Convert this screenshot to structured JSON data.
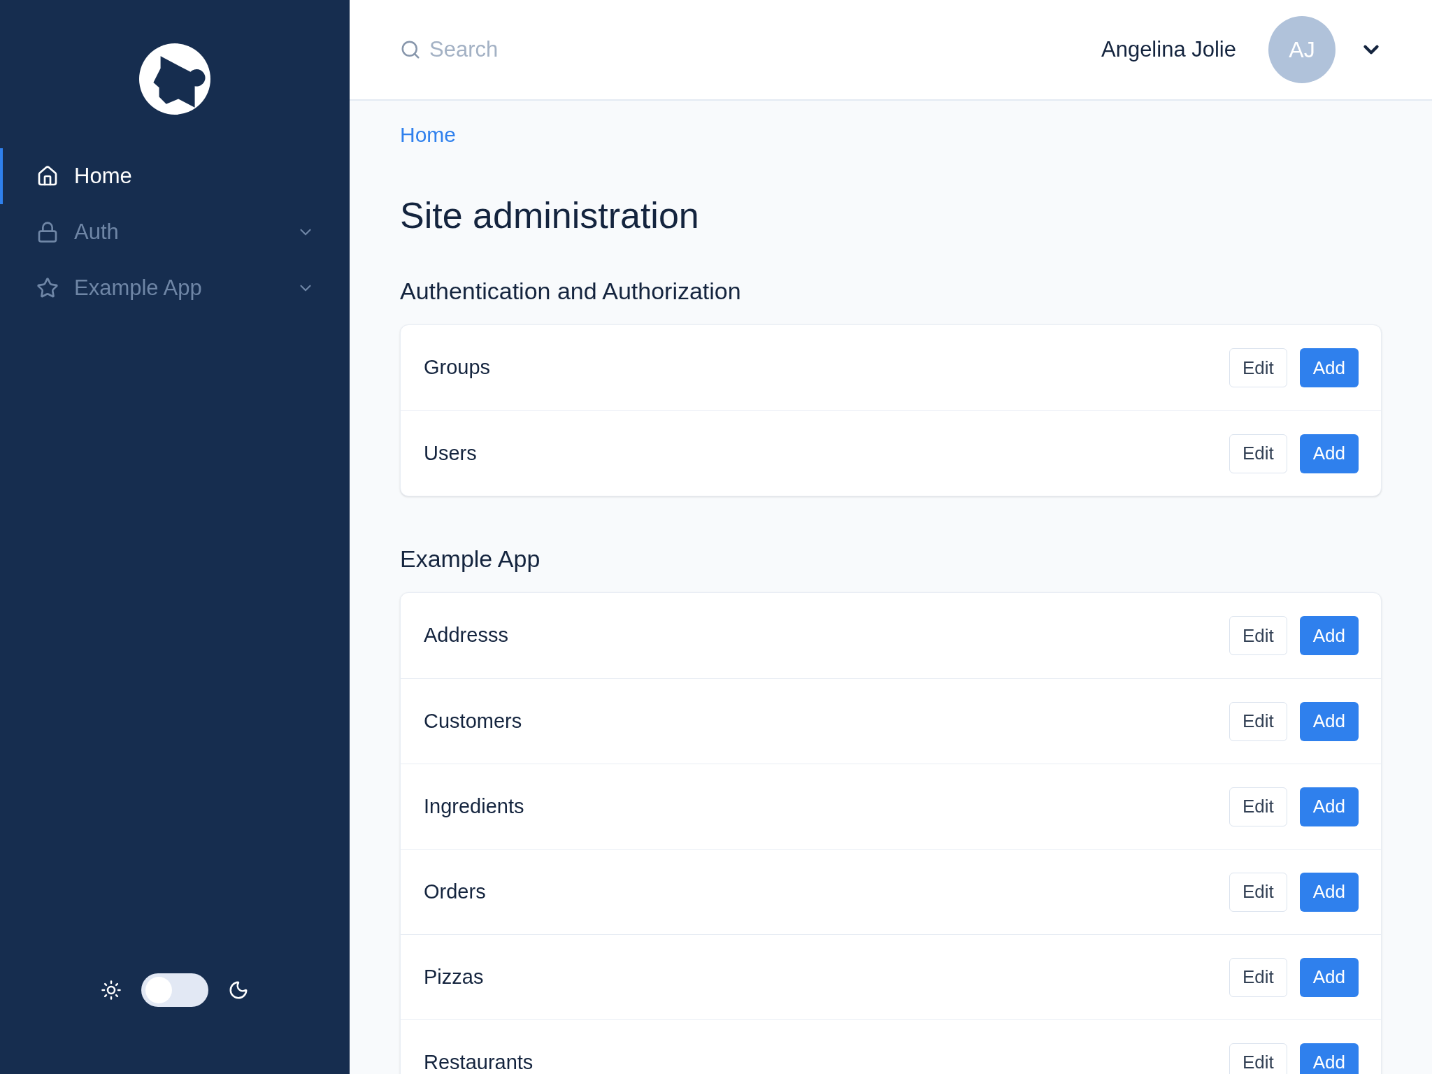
{
  "sidebar": {
    "items": [
      {
        "label": "Home",
        "kind": "home",
        "selected": true,
        "expandable": false
      },
      {
        "label": "Auth",
        "kind": "lock",
        "selected": false,
        "expandable": true
      },
      {
        "label": "Example App",
        "kind": "star",
        "selected": false,
        "expandable": true
      }
    ],
    "dark_mode_toggle": {
      "on": false
    }
  },
  "header": {
    "search": {
      "placeholder": "Search"
    },
    "user": {
      "name": "Angelina Jolie",
      "initials": "AJ"
    }
  },
  "breadcrumb": [
    "Home"
  ],
  "title": "Site administration",
  "sections": [
    {
      "heading": "Authentication and Authorization",
      "rows": [
        {
          "name": "Groups",
          "edit": "Edit",
          "add": "Add"
        },
        {
          "name": "Users",
          "edit": "Edit",
          "add": "Add"
        }
      ]
    },
    {
      "heading": "Example App",
      "rows": [
        {
          "name": "Addresss",
          "edit": "Edit",
          "add": "Add"
        },
        {
          "name": "Customers",
          "edit": "Edit",
          "add": "Add"
        },
        {
          "name": "Ingredients",
          "edit": "Edit",
          "add": "Add"
        },
        {
          "name": "Orders",
          "edit": "Edit",
          "add": "Add"
        },
        {
          "name": "Pizzas",
          "edit": "Edit",
          "add": "Add"
        },
        {
          "name": "Restaurants",
          "edit": "Edit",
          "add": "Add"
        }
      ]
    }
  ]
}
